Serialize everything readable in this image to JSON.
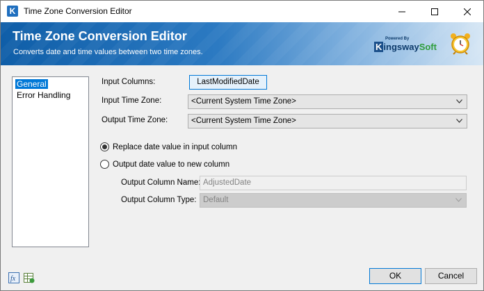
{
  "window": {
    "title": "Time Zone Conversion Editor",
    "app_icon_letter": "K"
  },
  "banner": {
    "title": "Time Zone Conversion Editor",
    "subtitle": "Converts date and time values between two time zones.",
    "logo_powered": "Powered By",
    "logo_k": "K",
    "logo_name": "ingsway",
    "logo_soft": "Soft"
  },
  "sidebar": {
    "items": [
      {
        "label": "General",
        "selected": true
      },
      {
        "label": "Error Handling",
        "selected": false
      }
    ]
  },
  "form": {
    "input_columns_label": "Input Columns:",
    "input_columns_value": "LastModifiedDate",
    "input_tz_label": "Input Time Zone:",
    "input_tz_value": "<Current System Time Zone>",
    "output_tz_label": "Output Time Zone:",
    "output_tz_value": "<Current System Time Zone>",
    "radio_replace_label": "Replace date value in input column",
    "radio_replace_checked": true,
    "radio_new_label": "Output date value to new column",
    "radio_new_checked": false,
    "output_col_name_label": "Output Column Name:",
    "output_col_name_value": "AdjustedDate",
    "output_col_type_label": "Output Column Type:",
    "output_col_type_value": "Default"
  },
  "footer": {
    "ok_label": "OK",
    "cancel_label": "Cancel",
    "icons": [
      "expression-fx-icon",
      "variables-grid-icon"
    ]
  },
  "colors": {
    "accent": "#0078d7",
    "banner_dark": "#0f5ea8",
    "banner_light": "#d7e7f5"
  }
}
